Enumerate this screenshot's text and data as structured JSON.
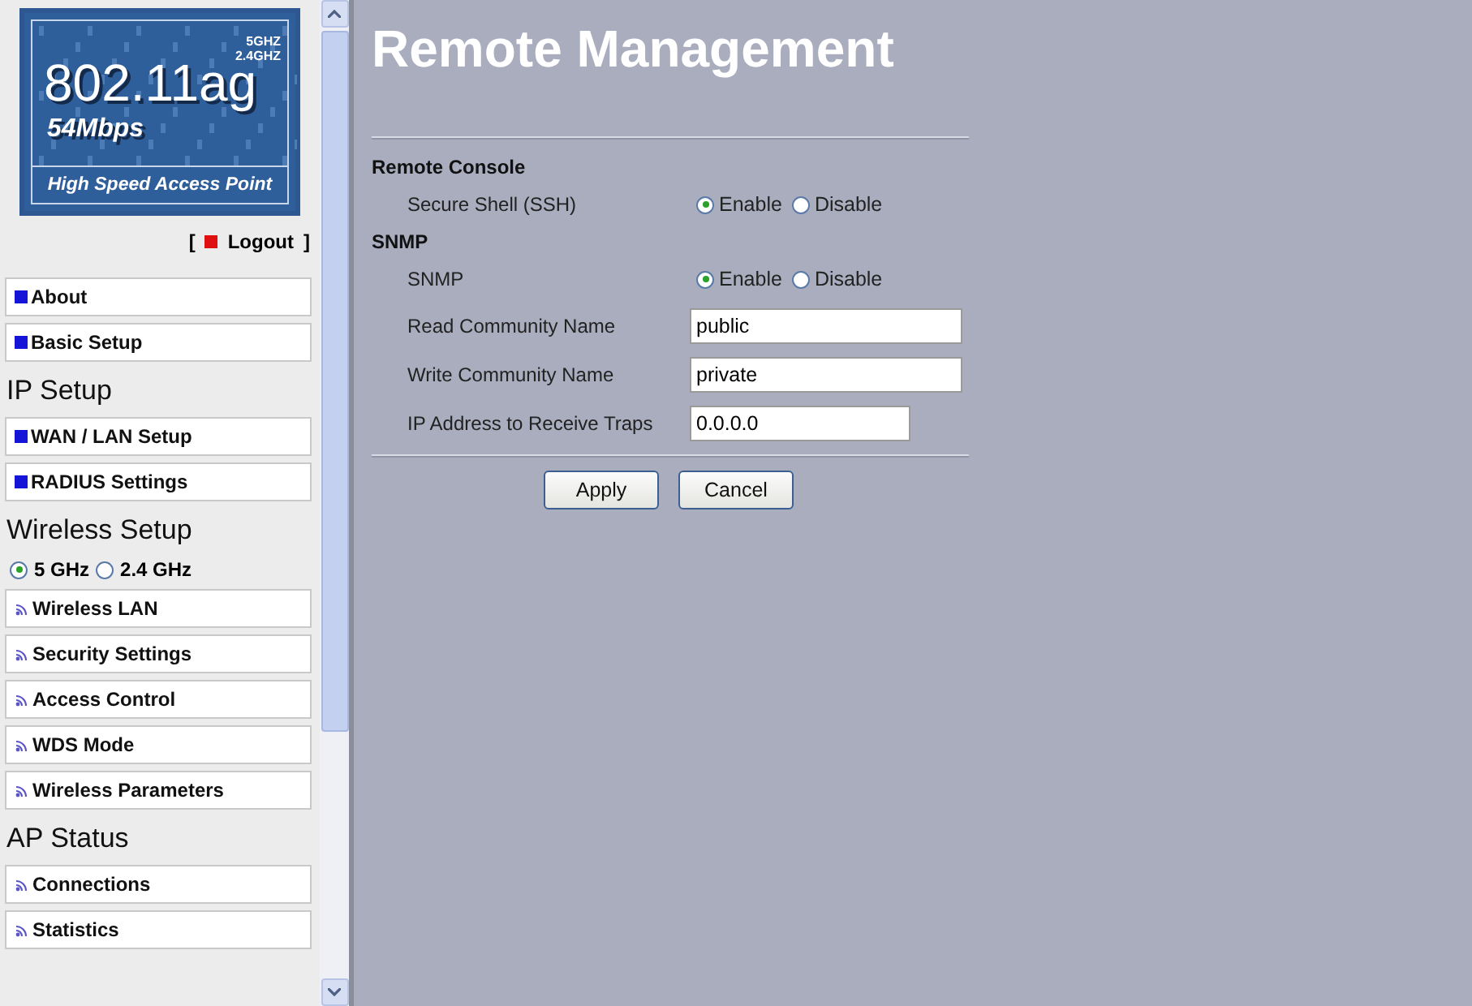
{
  "logo": {
    "bands": [
      "5GHZ",
      "2.4GHZ"
    ],
    "standard": "802.11ag",
    "speed": "54Mbps",
    "tagline": "High Speed Access Point"
  },
  "logout": {
    "open": "[",
    "label": "Logout",
    "close": "]"
  },
  "sidebar": {
    "sections": [
      {
        "items": [
          {
            "label": "About",
            "kind": "page"
          },
          {
            "label": "Basic Setup",
            "kind": "page"
          }
        ]
      },
      {
        "heading": "IP Setup",
        "items": [
          {
            "label": "WAN / LAN Setup",
            "kind": "page"
          },
          {
            "label": "RADIUS Settings",
            "kind": "page"
          }
        ]
      },
      {
        "heading": "Wireless Setup",
        "bands": [
          {
            "label": "5 GHz",
            "selected": true
          },
          {
            "label": "2.4 GHz",
            "selected": false
          }
        ],
        "items": [
          {
            "label": "Wireless LAN",
            "kind": "wireless"
          },
          {
            "label": "Security Settings",
            "kind": "wireless"
          },
          {
            "label": "Access Control",
            "kind": "wireless"
          },
          {
            "label": "WDS Mode",
            "kind": "wireless"
          },
          {
            "label": "Wireless Parameters",
            "kind": "wireless"
          }
        ]
      },
      {
        "heading": "AP Status",
        "items": [
          {
            "label": "Connections",
            "kind": "wireless"
          },
          {
            "label": "Statistics",
            "kind": "wireless"
          }
        ]
      }
    ]
  },
  "main": {
    "title": "Remote Management",
    "sections": [
      {
        "heading": "Remote Console",
        "rows": [
          {
            "kind": "radio",
            "label": "Secure Shell (SSH)",
            "options": [
              {
                "label": "Enable",
                "selected": true
              },
              {
                "label": "Disable",
                "selected": false
              }
            ]
          }
        ]
      },
      {
        "heading": "SNMP",
        "rows": [
          {
            "kind": "radio",
            "label": "SNMP",
            "options": [
              {
                "label": "Enable",
                "selected": true
              },
              {
                "label": "Disable",
                "selected": false
              }
            ]
          },
          {
            "kind": "text",
            "label": "Read Community Name",
            "value": "public"
          },
          {
            "kind": "text",
            "label": "Write Community Name",
            "value": "private"
          },
          {
            "kind": "address",
            "label": "IP Address to Receive Traps",
            "value": "0.0.0.0"
          }
        ]
      }
    ],
    "buttons": [
      "Apply",
      "Cancel"
    ]
  }
}
